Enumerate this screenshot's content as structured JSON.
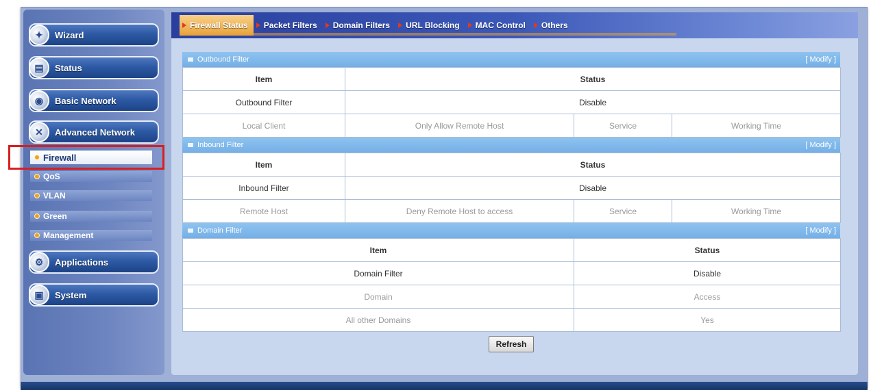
{
  "sidebar": {
    "menus": [
      {
        "label": "Wizard",
        "icon": "wizard-icon"
      },
      {
        "label": "Status",
        "icon": "status-icon"
      },
      {
        "label": "Basic Network",
        "icon": "basic-network-icon"
      },
      {
        "label": "Advanced Network",
        "icon": "advanced-network-icon"
      },
      {
        "label": "Applications",
        "icon": "applications-icon"
      },
      {
        "label": "System",
        "icon": "system-icon"
      }
    ],
    "sub_items": [
      "Firewall",
      "QoS",
      "VLAN",
      "Green",
      "Management"
    ],
    "active_sub_item": "Firewall"
  },
  "tabs": [
    "Firewall Status",
    "Packet Filters",
    "Domain Filters",
    "URL Blocking",
    "MAC Control",
    "Others"
  ],
  "active_tab": "Firewall Status",
  "modify_label": "[ Modify ]",
  "outbound": {
    "title": "Outbound Filter",
    "header": {
      "item": "Item",
      "status": "Status"
    },
    "row": {
      "item": "Outbound Filter",
      "status": "Disable"
    },
    "cols": [
      "Local Client",
      "Only Allow Remote Host",
      "Service",
      "Working Time"
    ]
  },
  "inbound": {
    "title": "Inbound Filter",
    "header": {
      "item": "Item",
      "status": "Status"
    },
    "row": {
      "item": "Inbound Filter",
      "status": "Disable"
    },
    "cols": [
      "Remote Host",
      "Deny Remote Host to access",
      "Service",
      "Working Time"
    ]
  },
  "domain": {
    "title": "Domain Filter",
    "header": {
      "item": "Item",
      "status": "Status"
    },
    "row": {
      "item": "Domain Filter",
      "status": "Disable"
    },
    "cols": [
      "Domain",
      "Access"
    ],
    "entries": [
      {
        "domain": "All other Domains",
        "access": "Yes"
      }
    ]
  },
  "refresh_label": "Refresh",
  "colors": {
    "accent_tab": "#e8a23a",
    "section_header": "#7fb7ea",
    "highlight": "#d81e1e"
  }
}
